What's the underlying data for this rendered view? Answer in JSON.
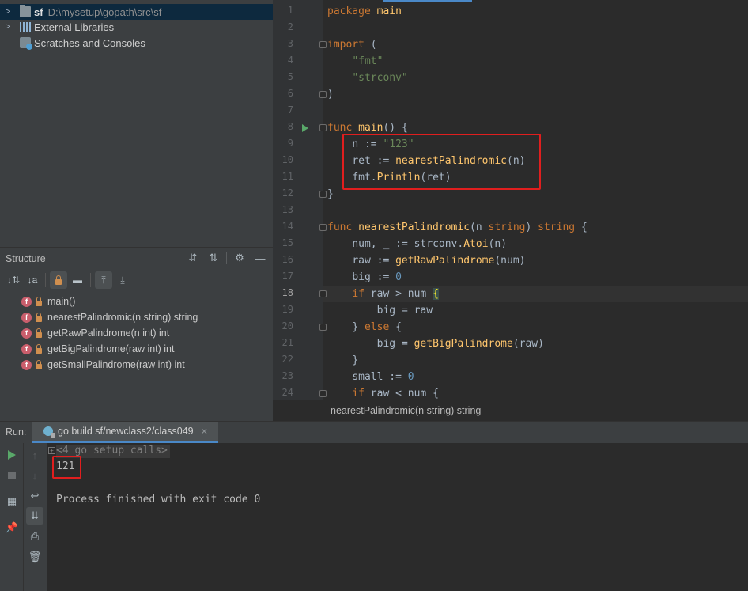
{
  "project": {
    "items": [
      {
        "name": "sf",
        "path": "D:\\mysetup\\gopath\\src\\sf",
        "icon": "folder-icon",
        "expand": ">"
      },
      {
        "name": "External Libraries",
        "icon": "library-icon",
        "expand": ">"
      },
      {
        "name": "Scratches and Consoles",
        "icon": "scratches-icon"
      }
    ]
  },
  "structure": {
    "title": "Structure",
    "items": [
      {
        "badge": "f",
        "label": "main()"
      },
      {
        "badge": "f",
        "label": "nearestPalindromic(n string) string"
      },
      {
        "badge": "f",
        "label": "getRawPalindrome(n int) int"
      },
      {
        "badge": "f",
        "label": "getBigPalindrome(raw int) int"
      },
      {
        "badge": "f",
        "label": "getSmallPalindrome(raw int) int"
      }
    ]
  },
  "editor": {
    "line_numbers": [
      "1",
      "2",
      "3",
      "4",
      "5",
      "6",
      "7",
      "8",
      "9",
      "10",
      "11",
      "12",
      "13",
      "14",
      "15",
      "16",
      "17",
      "18",
      "19",
      "20",
      "21",
      "22",
      "23",
      "24"
    ],
    "current_line": "18",
    "lines": [
      "package main",
      "",
      "import (",
      "    \"fmt\"",
      "    \"strconv\"",
      ")",
      "",
      "func main() {",
      "    n := \"123\"",
      "    ret := nearestPalindromic(n)",
      "    fmt.Println(ret)",
      "}",
      "",
      "func nearestPalindromic(n string) string {",
      "    num, _ := strconv.Atoi(n)",
      "    raw := getRawPalindrome(num)",
      "    big := 0",
      "    if raw > num {",
      "        big = raw",
      "    } else {",
      "        big = getBigPalindrome(raw)",
      "    }",
      "    small := 0",
      "    if raw < num {"
    ],
    "breadcrumb": "nearestPalindromic(n string) string"
  },
  "run": {
    "label": "Run:",
    "tab_label": "go build sf/newclass2/class049",
    "tab_close": "✕",
    "setup_calls": "<4 go setup calls>",
    "output_value": "121",
    "exit_message": "Process finished with exit code 0"
  },
  "colors": {
    "keyword": "#cc7832",
    "function": "#ffc66d",
    "string": "#6a8759",
    "number": "#6897bb",
    "highlight_box": "#e01e1e",
    "run_green": "#59a869"
  }
}
